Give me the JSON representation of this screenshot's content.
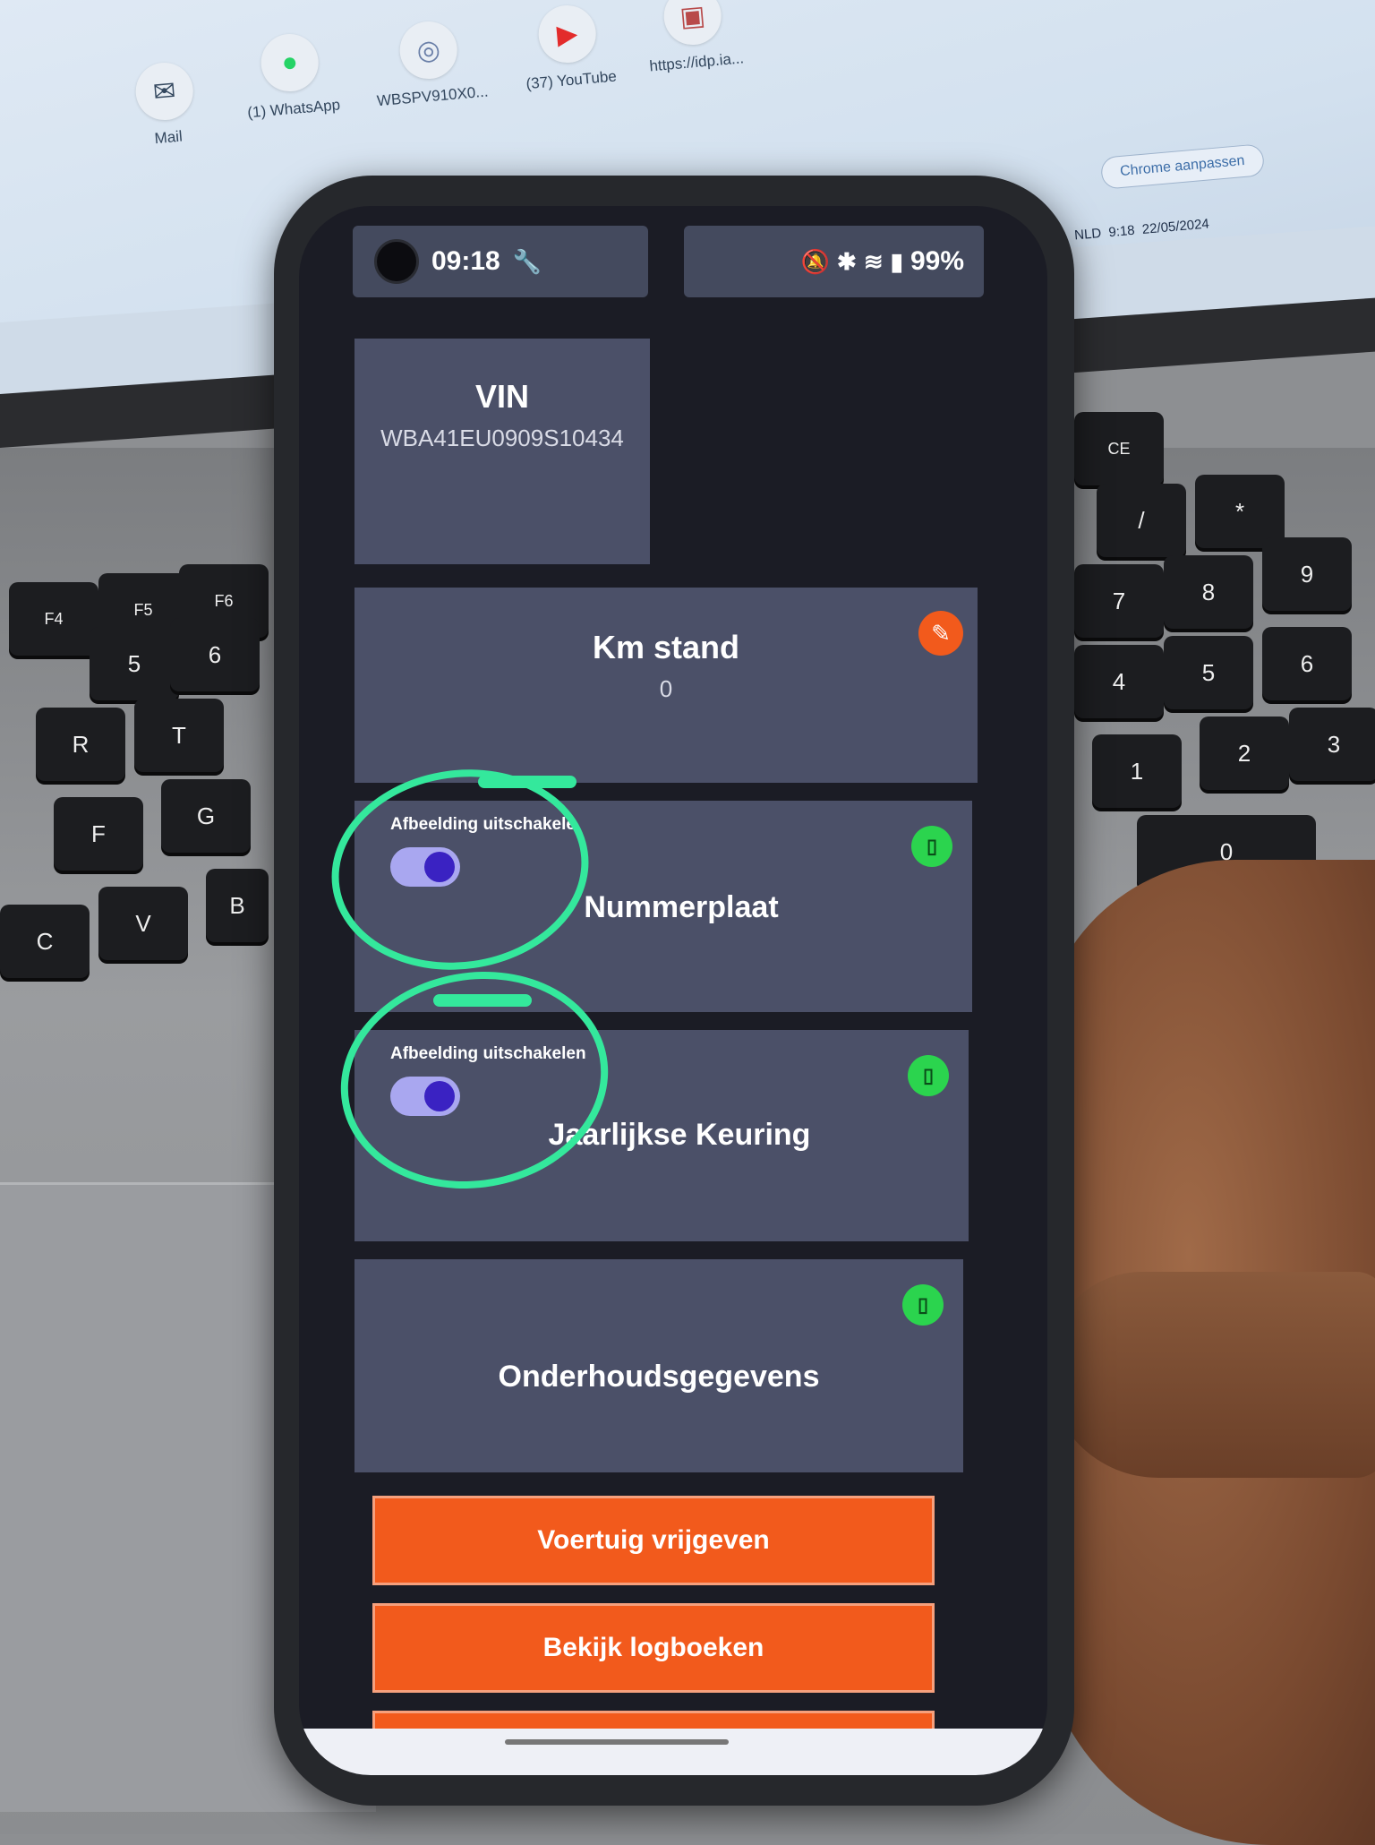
{
  "background": {
    "shortcuts": [
      {
        "label": "Mail",
        "icon": "outlook-icon"
      },
      {
        "label": "(1) WhatsApp",
        "icon": "whatsapp-icon"
      },
      {
        "label": "WBSPV910X0...",
        "icon": "app-icon"
      },
      {
        "label": "(37) YouTube",
        "icon": "youtube-icon"
      },
      {
        "label": "https://idp.ia...",
        "icon": "page-icon"
      }
    ],
    "chrome_button": "Chrome aanpassen",
    "tray_lang": "NLD",
    "tray_time": "9:18",
    "tray_date": "22/05/2024",
    "keys": [
      "F4",
      "F5",
      "F6",
      "5",
      "6",
      "R",
      "T",
      "F",
      "G",
      "V",
      "B",
      "C",
      "CE",
      "/",
      "*",
      "7",
      "8",
      "9",
      "4",
      "5",
      "6",
      "1",
      "2",
      "3",
      "0"
    ]
  },
  "status_bar": {
    "time": "09:18",
    "battery": "99%"
  },
  "cards": {
    "vin": {
      "title": "VIN",
      "value": "WBA41EU0909S10434"
    },
    "km": {
      "title": "Km stand",
      "value": "0"
    },
    "plate": {
      "title": "Nummerplaat",
      "toggle_label": "Afbeelding uitschakele"
    },
    "keuring": {
      "title": "Jaarlijkse Keuring",
      "toggle_label": "Afbeelding uitschakelen"
    },
    "onderhoud": {
      "title": "Onderhoudsgegevens"
    }
  },
  "buttons": {
    "release": "Voertuig vrijgeven",
    "logs": "Bekijk logboeken"
  },
  "colors": {
    "accent": "#f25a1c",
    "card": "#4b5068",
    "annotation": "#34e89c",
    "vibrate": "#2bd44e",
    "toggle_on": "#3a22c2"
  }
}
